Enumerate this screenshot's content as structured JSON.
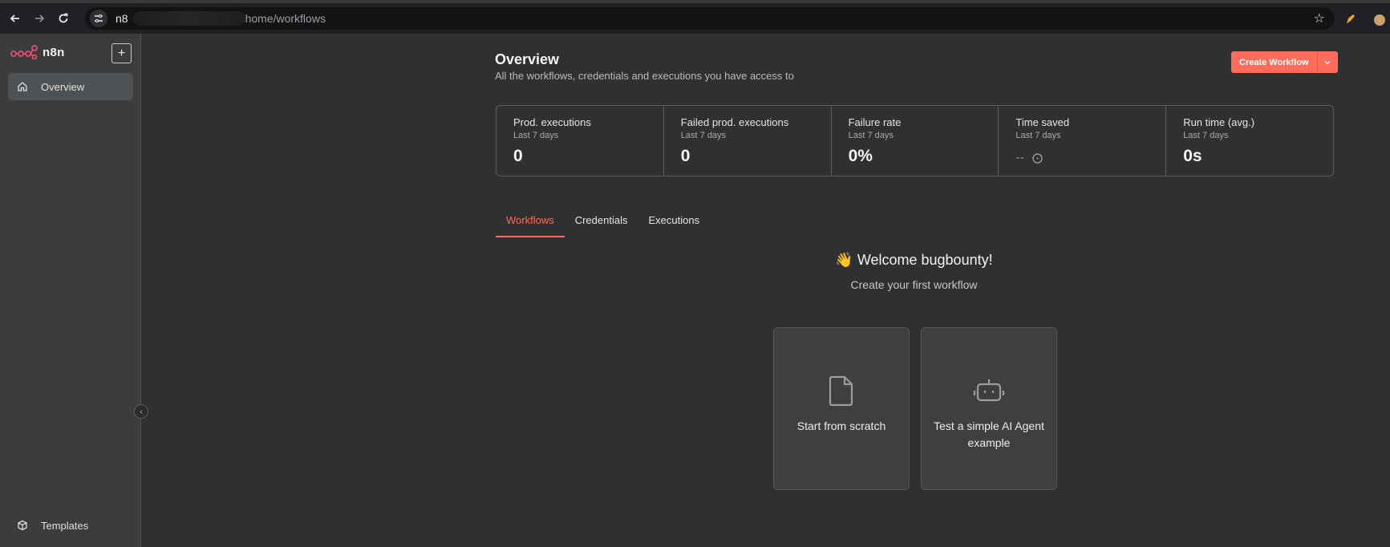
{
  "browser": {
    "url_host": "n8",
    "url_path": "home/workflows"
  },
  "sidebar": {
    "logo_text": "n8n",
    "add_label": "+",
    "items": [
      {
        "label": "Overview",
        "icon": "home-icon",
        "active": true
      },
      {
        "label": "Templates",
        "icon": "box-icon",
        "active": false
      }
    ]
  },
  "header": {
    "title": "Overview",
    "subtitle": "All the workflows, credentials and executions you have access to",
    "create_label": "Create Workflow"
  },
  "stats": [
    {
      "label": "Prod. executions",
      "period": "Last 7 days",
      "value": "0"
    },
    {
      "label": "Failed prod. executions",
      "period": "Last 7 days",
      "value": "0"
    },
    {
      "label": "Failure rate",
      "period": "Last 7 days",
      "value": "0%"
    },
    {
      "label": "Time saved",
      "period": "Last 7 days",
      "value": "--"
    },
    {
      "label": "Run time (avg.)",
      "period": "Last 7 days",
      "value": "0s"
    }
  ],
  "tabs": [
    {
      "label": "Workflows",
      "active": true
    },
    {
      "label": "Credentials",
      "active": false
    },
    {
      "label": "Executions",
      "active": false
    }
  ],
  "welcome": {
    "title": "👋 Welcome bugbounty!",
    "subtitle": "Create your first workflow"
  },
  "cards": [
    {
      "label": "Start from scratch",
      "icon": "file-icon"
    },
    {
      "label": "Test a simple AI Agent example",
      "icon": "robot-icon"
    }
  ],
  "colors": {
    "accent": "#ff6d5a",
    "background": "#2e3031",
    "sidebar": "#3a3c3e"
  }
}
